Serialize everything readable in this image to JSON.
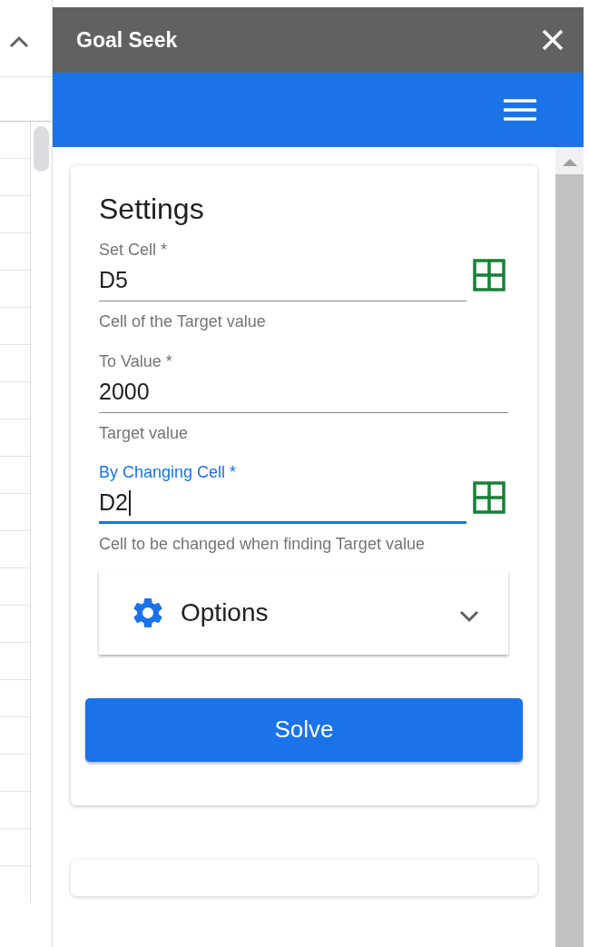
{
  "window": {
    "title": "Goal Seek"
  },
  "settings": {
    "title": "Settings",
    "fields": [
      {
        "label": "Set Cell *",
        "value": "D5",
        "hint": "Cell of the Target value",
        "focused": false,
        "range_picker": true
      },
      {
        "label": "To Value *",
        "value": "2000",
        "hint": "Target value",
        "focused": false,
        "range_picker": false
      },
      {
        "label": "By Changing Cell *",
        "value": "D2",
        "hint": "Cell to be changed when finding Target value",
        "focused": true,
        "range_picker": true
      }
    ],
    "options": {
      "label": "Options",
      "expanded": false
    },
    "solve_button": "Solve"
  }
}
